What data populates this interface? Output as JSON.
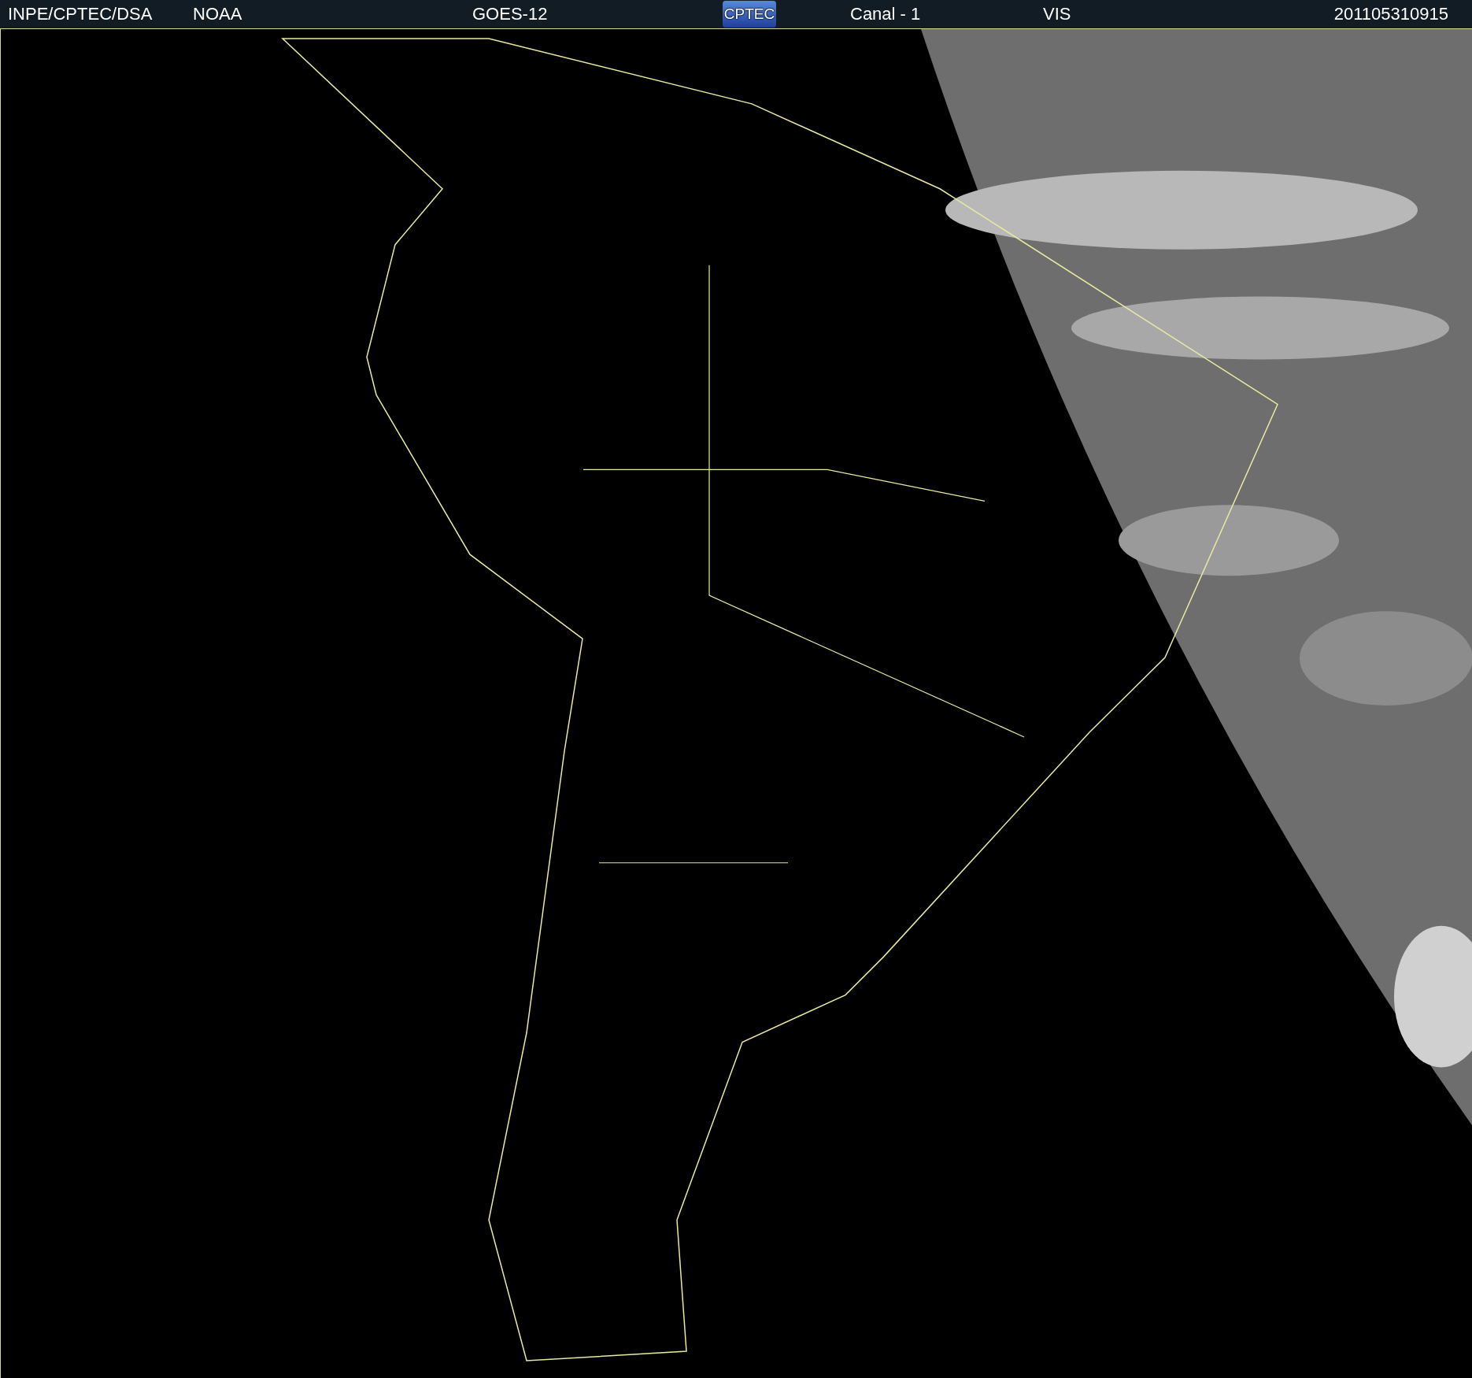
{
  "header": {
    "items": [
      {
        "kind": "text",
        "text": "INPE/CPTEC/DSA"
      },
      {
        "kind": "text",
        "text": "NOAA"
      },
      {
        "kind": "text",
        "text": "GOES-12"
      },
      {
        "kind": "logo",
        "text": "CPTEC"
      },
      {
        "kind": "text",
        "text": "Canal - 1"
      },
      {
        "kind": "text",
        "text": "VIS"
      },
      {
        "kind": "text",
        "text": "201105310915"
      }
    ]
  }
}
